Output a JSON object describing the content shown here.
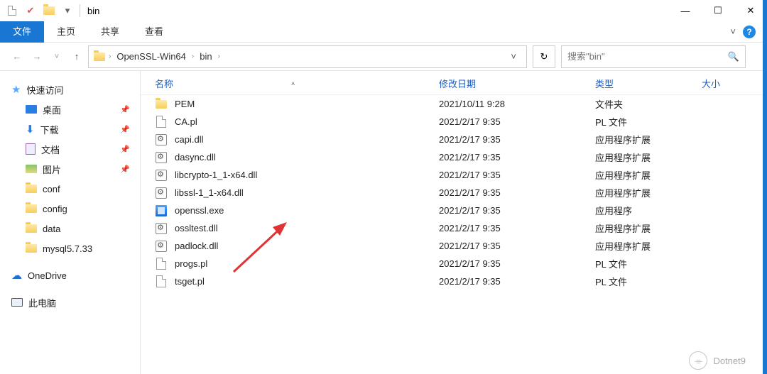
{
  "titlebar": {
    "title": "bin",
    "controls": {
      "min": "—",
      "max": "☐",
      "close": "✕"
    }
  },
  "ribbon": {
    "tabs": [
      "文件",
      "主页",
      "共享",
      "查看"
    ],
    "active_index": 0,
    "expand": "˅",
    "help": "?"
  },
  "nav": {
    "back": "←",
    "forward": "→",
    "recent": "˅",
    "up": "↑",
    "refresh": "↻",
    "breadcrumb": [
      "OpenSSL-Win64",
      "bin"
    ],
    "search_placeholder": "搜索\"bin\"",
    "search_icon": "🔍"
  },
  "sidebar": {
    "quick_access": "快速访问",
    "items": [
      {
        "label": "桌面",
        "pinned": true,
        "icon": "desktop"
      },
      {
        "label": "下载",
        "pinned": true,
        "icon": "download"
      },
      {
        "label": "文档",
        "pinned": true,
        "icon": "doc"
      },
      {
        "label": "图片",
        "pinned": true,
        "icon": "pic"
      },
      {
        "label": "conf",
        "pinned": false,
        "icon": "folder"
      },
      {
        "label": "config",
        "pinned": false,
        "icon": "folder"
      },
      {
        "label": "data",
        "pinned": false,
        "icon": "folder"
      },
      {
        "label": "mysql5.7.33",
        "pinned": false,
        "icon": "folder"
      }
    ],
    "onedrive": "OneDrive",
    "this_pc": "此电脑"
  },
  "columns": {
    "name": "名称",
    "date": "修改日期",
    "type": "类型",
    "size": "大小",
    "sort_indicator": "˄"
  },
  "files": [
    {
      "name": "PEM",
      "date": "2021/10/11 9:28",
      "type": "文件夹",
      "icon": "folder"
    },
    {
      "name": "CA.pl",
      "date": "2021/2/17 9:35",
      "type": "PL 文件",
      "icon": "page"
    },
    {
      "name": "capi.dll",
      "date": "2021/2/17 9:35",
      "type": "应用程序扩展",
      "icon": "gear"
    },
    {
      "name": "dasync.dll",
      "date": "2021/2/17 9:35",
      "type": "应用程序扩展",
      "icon": "gear"
    },
    {
      "name": "libcrypto-1_1-x64.dll",
      "date": "2021/2/17 9:35",
      "type": "应用程序扩展",
      "icon": "gear"
    },
    {
      "name": "libssl-1_1-x64.dll",
      "date": "2021/2/17 9:35",
      "type": "应用程序扩展",
      "icon": "gear"
    },
    {
      "name": "openssl.exe",
      "date": "2021/2/17 9:35",
      "type": "应用程序",
      "icon": "exe"
    },
    {
      "name": "ossltest.dll",
      "date": "2021/2/17 9:35",
      "type": "应用程序扩展",
      "icon": "gear"
    },
    {
      "name": "padlock.dll",
      "date": "2021/2/17 9:35",
      "type": "应用程序扩展",
      "icon": "gear"
    },
    {
      "name": "progs.pl",
      "date": "2021/2/17 9:35",
      "type": "PL 文件",
      "icon": "page"
    },
    {
      "name": "tsget.pl",
      "date": "2021/2/17 9:35",
      "type": "PL 文件",
      "icon": "page"
    }
  ],
  "watermark": "Dotnet9"
}
